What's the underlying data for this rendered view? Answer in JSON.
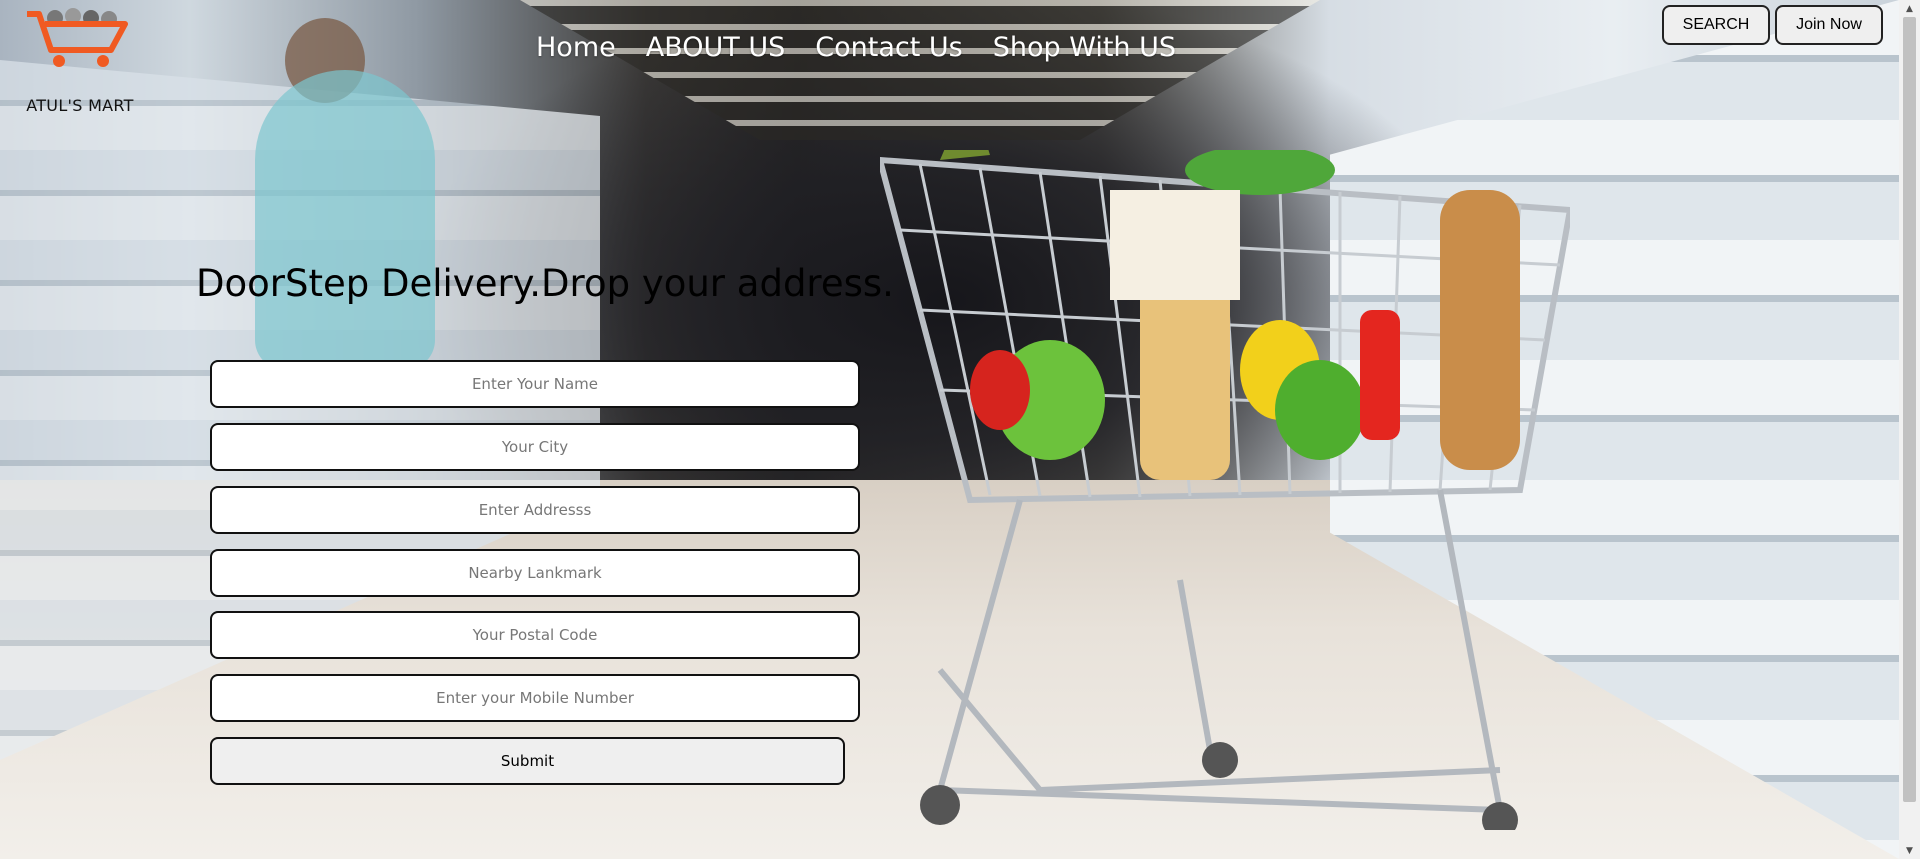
{
  "brand": {
    "name": "ATUL'S MART",
    "logo_icon": "shopping-cart-icon",
    "logo_color": "#f05a22"
  },
  "nav": {
    "items": [
      {
        "label": "Home"
      },
      {
        "label": "ABOUT US"
      },
      {
        "label": "Contact Us"
      },
      {
        "label": "Shop With US"
      }
    ]
  },
  "header_buttons": {
    "search_label": "SEARCH",
    "join_label": "Join Now"
  },
  "hero": {
    "title": "DoorStep Delivery.Drop your address."
  },
  "form": {
    "fields": [
      {
        "placeholder": "Enter Your Name",
        "value": ""
      },
      {
        "placeholder": "Your City",
        "value": ""
      },
      {
        "placeholder": "Enter Addresss",
        "value": ""
      },
      {
        "placeholder": "Nearby Lankmark",
        "value": ""
      },
      {
        "placeholder": "Your Postal Code",
        "value": ""
      },
      {
        "placeholder": "Enter your Mobile Number",
        "value": ""
      }
    ],
    "submit_label": "Submit"
  },
  "background": {
    "scene": "supermarket-aisle-with-shopping-cart"
  }
}
